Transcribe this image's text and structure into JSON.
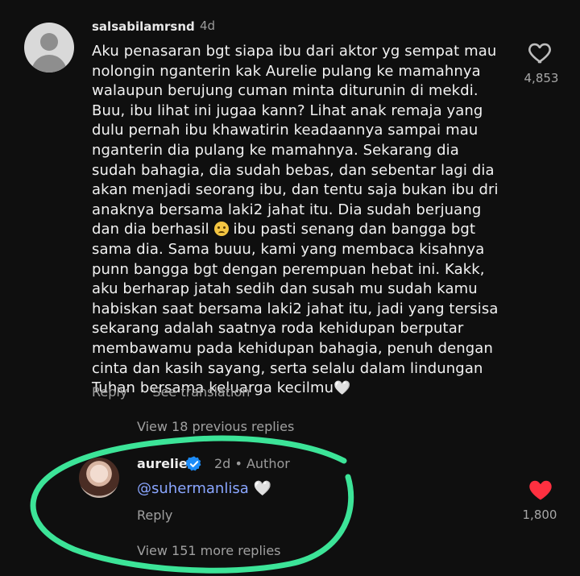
{
  "comment": {
    "username": "salsabilamrsnd",
    "time": "4d",
    "text_lines": [
      "Aku penasaran bgt siapa ibu dari aktor yg sempat mau",
      "nolongin nganterin kak Aurelie pulang ke mamahnya",
      "walaupun berujung cuman minta diturunin di mekdi.",
      "Buu, ibu lihat ini jugaa kann? Lihat anak remaja yang",
      "dulu pernah ibu khawatirin keadaannya sampai mau",
      "nganterin dia pulang ke mamahnya. Sekarang dia",
      "sudah bahagia, dia sudah bebas, dan sebentar lagi dia",
      "akan menjadi seorang ibu, dan tentu saja bukan ibu dri",
      "anaknya bersama laki2 jahat itu. Dia sudah berjuang",
      "dan dia berhasil",
      "ibu pasti senang dan bangga bgt",
      "sama dia. Sama buuu, kami yang membaca kisahnya",
      "punn bangga bgt dengan perempuan hebat ini. Kakk,",
      "aku berharap jatah sedih dan susah mu sudah kamu",
      "habiskan saat bersama laki2 jahat itu, jadi yang tersisa",
      "sekarang adalah saatnya roda kehidupan berputar",
      "membawamu pada kehidupan bahagia, penuh dengan",
      "cinta dan kasih sayang, serta selalu dalam lindungan",
      "Tuhan bersama keluarga kecilmu",
      "🤍"
    ],
    "like_count": "4,853",
    "reply_label": "Reply",
    "translate_label": "See translation",
    "view_previous": "View 18 previous replies"
  },
  "reply": {
    "username": "aurelie",
    "time": "2d",
    "separator": "•",
    "author_badge": "Author",
    "mention": "@suhermanlisa",
    "heart": "🤍",
    "like_count": "1,800",
    "reply_label": "Reply",
    "view_more": "View 151 more replies",
    "liked": true
  },
  "colors": {
    "background": "#0f0f0f",
    "like_red": "#ff3040",
    "verified_blue": "#1d8cf8",
    "mention_blue": "#8aa6ff",
    "highlight_green": "#3ff0a0"
  },
  "icons": [
    "user-placeholder-icon",
    "heart-outline-icon",
    "verified-badge-icon",
    "heart-filled-icon",
    "pleading-face-emoji"
  ]
}
